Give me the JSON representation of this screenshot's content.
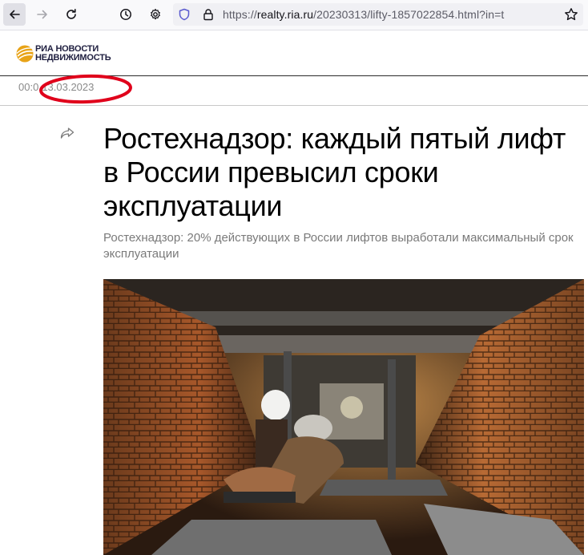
{
  "browser": {
    "url_prefix": "https://",
    "url_host": "realty.ria.ru",
    "url_path": "/20230313/lifty-1857022854.html?in=t",
    "icons": {
      "back": "arrow-left-icon",
      "forward": "arrow-right-icon",
      "reload": "reload-icon",
      "history": "clock-icon",
      "settings": "gear-icon",
      "tracking": "shield-icon",
      "security": "lock-icon",
      "bookmark": "star-icon"
    }
  },
  "site": {
    "logo_line1": "РИА НОВОСТИ",
    "logo_line2": "НЕДВИЖИМОСТЬ",
    "brand_color": "#e8a317"
  },
  "article": {
    "time": "00:0",
    "date": "13.03.2023",
    "title": "Ростехнадзор: каждый пятый лифт в России превысил сроки эксплуатации",
    "subtitle": "Ростехнадзор: 20% действующих в России лифтов выработали максимальный срок эксплуатации"
  },
  "annotation_color": "#e0001b"
}
